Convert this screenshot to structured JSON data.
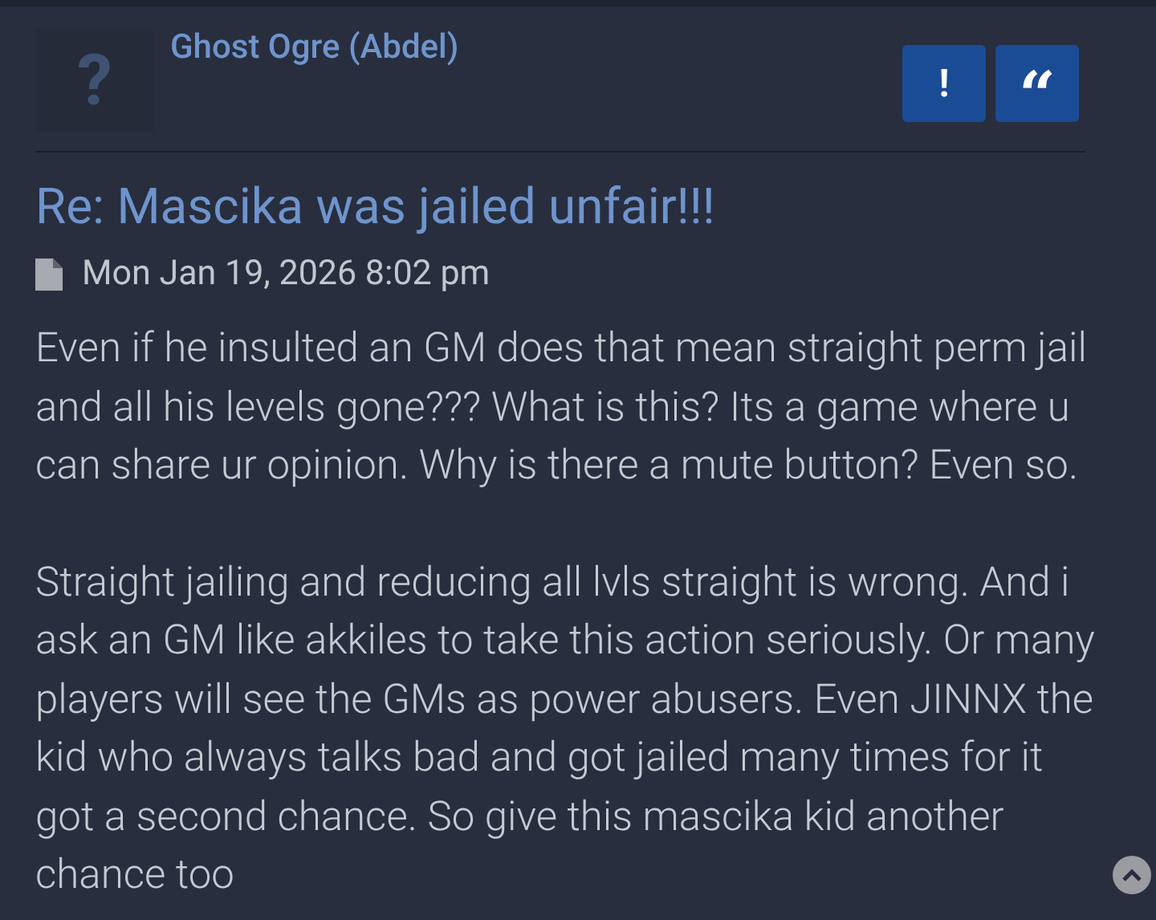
{
  "post": {
    "avatar_mark": "?",
    "author": "Ghost Ogre (Abdel)",
    "buttons": [
      {
        "kind": "report",
        "label": "!"
      },
      {
        "kind": "quote",
        "label": "“"
      }
    ],
    "title": "Re: Mascika was jailed unfair!!!",
    "date": "Mon Jan 19, 2026 8:02 pm",
    "paragraphs": [
      "Even if he insulted an GM does that mean straight perm jail and all his levels gone??? What is this? Its a game where u can share ur opinion. Why is there a mute button? Even so.",
      "Straight jailing and reducing all lvls straight is wrong. And i ask an GM like akkiles to take this action seriously. Or many players will see the GMs as power abusers. Even JINNX the kid who always talks bad and got jailed many times for it got a second chance. So give this mascika kid another chance too"
    ]
  }
}
